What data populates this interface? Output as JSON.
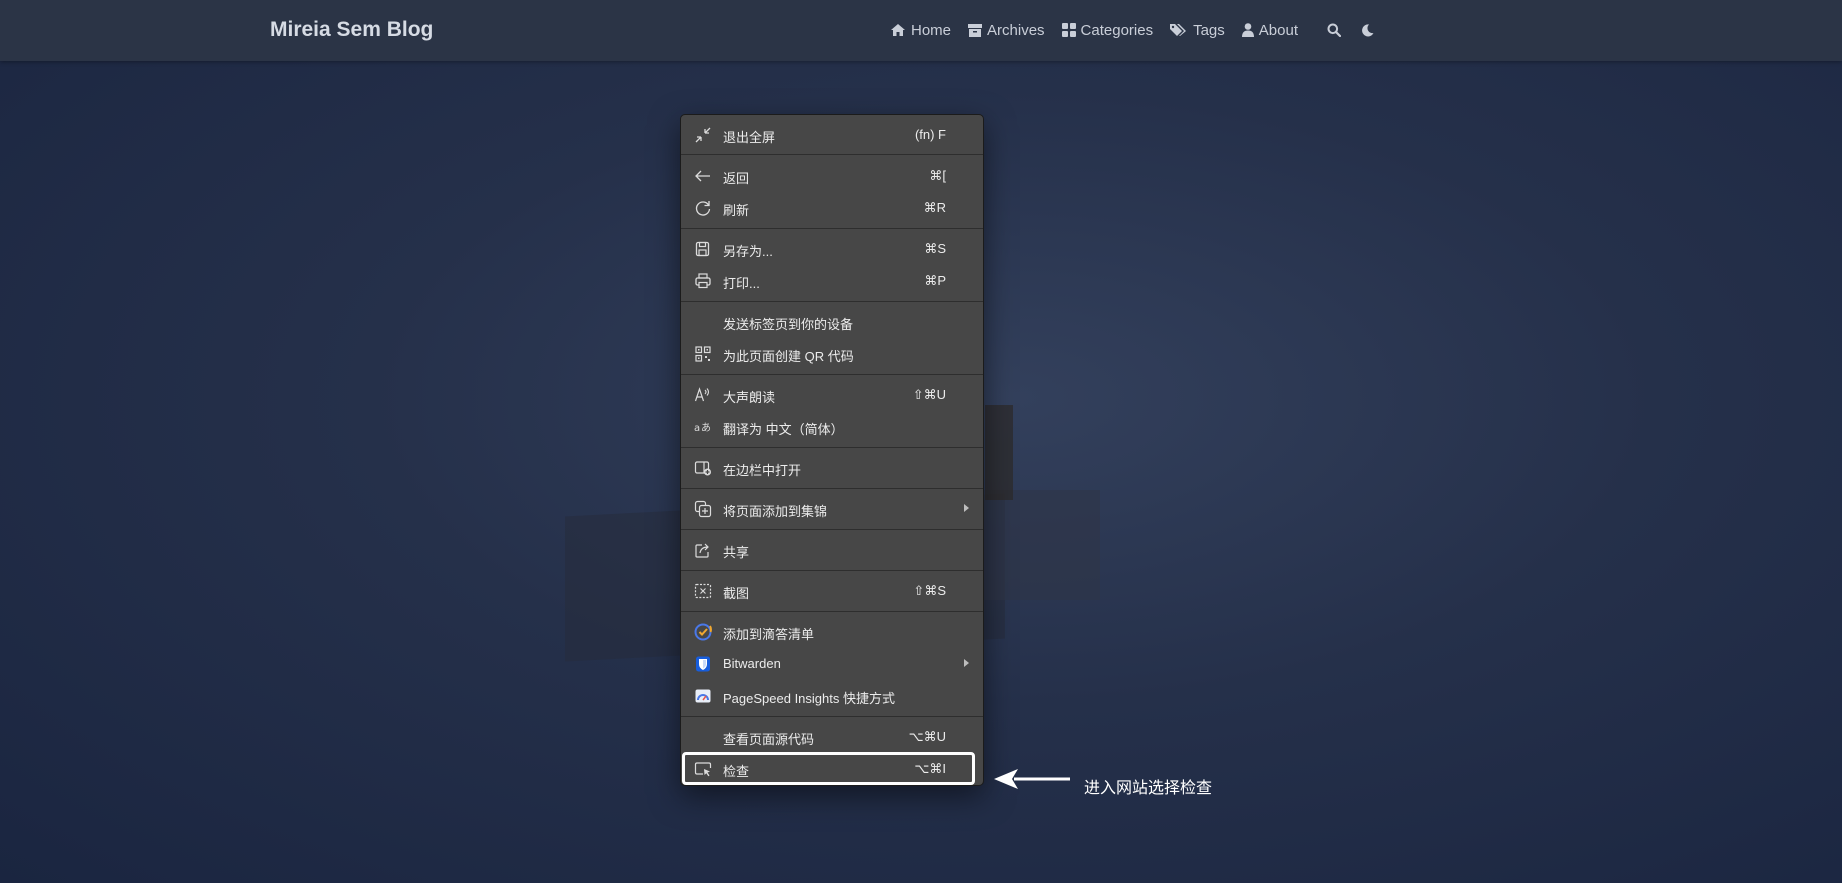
{
  "site": {
    "title": "Mireia Sem Blog"
  },
  "nav": {
    "items": [
      {
        "label": "Home",
        "icon": "home-icon"
      },
      {
        "label": "Archives",
        "icon": "archive-icon"
      },
      {
        "label": "Categories",
        "icon": "categories-icon"
      },
      {
        "label": "Tags",
        "icon": "tags-icon"
      },
      {
        "label": "About",
        "icon": "user-icon"
      }
    ],
    "search_icon": "search-icon",
    "theme_icon": "moon-icon"
  },
  "context_menu": {
    "exit_fullscreen": {
      "label": "退出全屏",
      "shortcut": "(fn) F"
    },
    "back": {
      "label": "返回",
      "shortcut": "⌘["
    },
    "refresh": {
      "label": "刷新",
      "shortcut": "⌘R"
    },
    "save_as": {
      "label": "另存为...",
      "shortcut": "⌘S"
    },
    "print": {
      "label": "打印...",
      "shortcut": "⌘P"
    },
    "send_tab": {
      "label": "发送标签页到你的设备"
    },
    "qr_code": {
      "label": "为此页面创建 QR 代码"
    },
    "read_aloud": {
      "label": "大声朗读",
      "shortcut": "⇧⌘U"
    },
    "translate": {
      "label": "翻译为 中文（简体）"
    },
    "open_sidebar": {
      "label": "在边栏中打开"
    },
    "add_collection": {
      "label": "将页面添加到集锦"
    },
    "share": {
      "label": "共享"
    },
    "screenshot": {
      "label": "截图",
      "shortcut": "⇧⌘S"
    },
    "add_ticktick": {
      "label": "添加到滴答清单"
    },
    "bitwarden": {
      "label": "Bitwarden"
    },
    "pagespeed": {
      "label": "PageSpeed Insights 快捷方式"
    },
    "view_source": {
      "label": "查看页面源代码",
      "shortcut": "⌥⌘U"
    },
    "inspect": {
      "label": "检查",
      "shortcut": "⌥⌘I"
    }
  },
  "annotation": {
    "text": "进入网站选择检查"
  },
  "colors": {
    "menu_bg": "#474747",
    "navbar_bg": "#2b3446",
    "highlight": "#ffffff"
  }
}
